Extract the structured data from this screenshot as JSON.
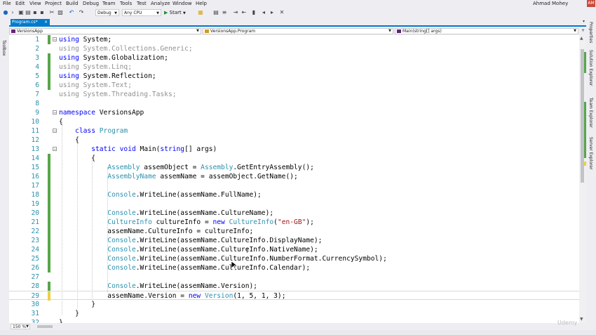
{
  "menu": [
    "File",
    "Edit",
    "View",
    "Project",
    "Build",
    "Debug",
    "Team",
    "Tools",
    "Test",
    "Analyze",
    "Window",
    "Help"
  ],
  "user": {
    "name": "Ahmad Mohey",
    "initials": "AM"
  },
  "toolbar": {
    "configuration": "Debug",
    "platform": "Any CPU",
    "start_label": "Start"
  },
  "toolbox_label": "Toolbox",
  "tab": {
    "label": "Program.cs*",
    "close": "×"
  },
  "nav": {
    "project": "VersionsApp",
    "class": "VersionsApp.Program",
    "member": "Main(string[] args)"
  },
  "right_panels": [
    "Properties",
    "Solution Explorer",
    "Team Explorer",
    "Server Explorer"
  ],
  "zoom": "150 %",
  "accent": "#007acc",
  "change_saved_color": "#57a64a",
  "change_unsaved_color": "#efce4a",
  "watermark": "Udemy",
  "code_lines": [
    {
      "n": "1",
      "c": "s",
      "fold": "-",
      "t": [
        [
          "kw",
          "using"
        ],
        [
          "pl",
          " System;"
        ]
      ]
    },
    {
      "n": "2",
      "c": "",
      "t": [
        [
          "gray",
          "using System.Collections.Generic;"
        ]
      ]
    },
    {
      "n": "3",
      "c": "s",
      "t": [
        [
          "kw",
          "using"
        ],
        [
          "pl",
          " System.Globalization;"
        ]
      ]
    },
    {
      "n": "4",
      "c": "s",
      "t": [
        [
          "gray",
          "using System.Linq;"
        ]
      ]
    },
    {
      "n": "5",
      "c": "s",
      "t": [
        [
          "kw",
          "using"
        ],
        [
          "pl",
          " System.Reflection;"
        ]
      ]
    },
    {
      "n": "6",
      "c": "s",
      "t": [
        [
          "gray",
          "using System.Text;"
        ]
      ]
    },
    {
      "n": "7",
      "c": "",
      "t": [
        [
          "gray",
          "using System.Threading.Tasks;"
        ]
      ]
    },
    {
      "n": "8",
      "c": "",
      "t": []
    },
    {
      "n": "9",
      "c": "",
      "fold": "-",
      "t": [
        [
          "kw",
          "namespace"
        ],
        [
          "pl",
          " VersionsApp"
        ]
      ]
    },
    {
      "n": "10",
      "c": "",
      "t": [
        [
          "pl",
          "{"
        ]
      ]
    },
    {
      "n": "11",
      "c": "",
      "fold": "-",
      "t": [
        [
          "pl",
          "    "
        ],
        [
          "kw",
          "class"
        ],
        [
          "pl",
          " "
        ],
        [
          "ty",
          "Program"
        ]
      ]
    },
    {
      "n": "12",
      "c": "",
      "t": [
        [
          "pl",
          "    {"
        ]
      ]
    },
    {
      "n": "13",
      "c": "",
      "fold": "-",
      "t": [
        [
          "pl",
          "        "
        ],
        [
          "kw",
          "static void"
        ],
        [
          "pl",
          " Main("
        ],
        [
          "kw",
          "string"
        ],
        [
          "pl",
          "[] args)"
        ]
      ]
    },
    {
      "n": "14",
      "c": "s",
      "t": [
        [
          "pl",
          "        {"
        ]
      ]
    },
    {
      "n": "15",
      "c": "s",
      "t": [
        [
          "pl",
          "            "
        ],
        [
          "ty",
          "Assembly"
        ],
        [
          "pl",
          " assemObject = "
        ],
        [
          "ty",
          "Assembly"
        ],
        [
          "pl",
          ".GetEntryAssembly();"
        ]
      ]
    },
    {
      "n": "16",
      "c": "s",
      "t": [
        [
          "pl",
          "            "
        ],
        [
          "ty",
          "AssemblyName"
        ],
        [
          "pl",
          " assemName = assemObject.GetName();"
        ]
      ]
    },
    {
      "n": "17",
      "c": "s",
      "t": []
    },
    {
      "n": "18",
      "c": "s",
      "t": [
        [
          "pl",
          "            "
        ],
        [
          "ty",
          "Console"
        ],
        [
          "pl",
          ".WriteLine(assemName.FullName);"
        ]
      ]
    },
    {
      "n": "19",
      "c": "s",
      "t": []
    },
    {
      "n": "20",
      "c": "s",
      "t": [
        [
          "pl",
          "            "
        ],
        [
          "ty",
          "Console"
        ],
        [
          "pl",
          ".WriteLine(assemName.CultureName);"
        ]
      ]
    },
    {
      "n": "21",
      "c": "s",
      "t": [
        [
          "pl",
          "            "
        ],
        [
          "ty",
          "CultureInfo"
        ],
        [
          "pl",
          " cultureInfo = "
        ],
        [
          "kw",
          "new"
        ],
        [
          "pl",
          " "
        ],
        [
          "ty",
          "CultureInfo"
        ],
        [
          "pl",
          "("
        ],
        [
          "st",
          "\"en-GB\""
        ],
        [
          "pl",
          ");"
        ]
      ]
    },
    {
      "n": "22",
      "c": "s",
      "t": [
        [
          "pl",
          "            assemName.CultureInfo = cultureInfo;"
        ]
      ]
    },
    {
      "n": "23",
      "c": "s",
      "t": [
        [
          "pl",
          "            "
        ],
        [
          "ty",
          "Console"
        ],
        [
          "pl",
          ".WriteLine(assemName.CultureInfo.DisplayName);"
        ]
      ]
    },
    {
      "n": "24",
      "c": "s",
      "t": [
        [
          "pl",
          "            "
        ],
        [
          "ty",
          "Console"
        ],
        [
          "pl",
          ".WriteLine(assemName.CultureInfo.NativeName);"
        ]
      ]
    },
    {
      "n": "25",
      "c": "s",
      "t": [
        [
          "pl",
          "            "
        ],
        [
          "ty",
          "Console"
        ],
        [
          "pl",
          ".WriteLine(assemName.CultureInfo.NumberFormat.CurrencySymbol);"
        ]
      ]
    },
    {
      "n": "26",
      "c": "s",
      "t": [
        [
          "pl",
          "            "
        ],
        [
          "ty",
          "Console"
        ],
        [
          "pl",
          ".WriteLine(assemName.CultureInfo.Calendar);"
        ]
      ]
    },
    {
      "n": "27",
      "c": "",
      "t": []
    },
    {
      "n": "28",
      "c": "s",
      "t": [
        [
          "pl",
          "            "
        ],
        [
          "ty",
          "Console"
        ],
        [
          "pl",
          ".WriteLine(assemName.Version);"
        ]
      ]
    },
    {
      "n": "29",
      "c": "u",
      "t": [
        [
          "pl",
          "            assemName.Version = "
        ],
        [
          "kw",
          "new"
        ],
        [
          "pl",
          " "
        ],
        [
          "ty",
          "Version"
        ],
        [
          "pl",
          "(1, 5, 1, 3);"
        ]
      ]
    },
    {
      "n": "30",
      "c": "",
      "t": [
        [
          "pl",
          "        }"
        ]
      ]
    },
    {
      "n": "31",
      "c": "",
      "t": [
        [
          "pl",
          "    }"
        ]
      ]
    },
    {
      "n": "32",
      "c": "",
      "t": [
        [
          "pl",
          "}"
        ]
      ]
    }
  ]
}
